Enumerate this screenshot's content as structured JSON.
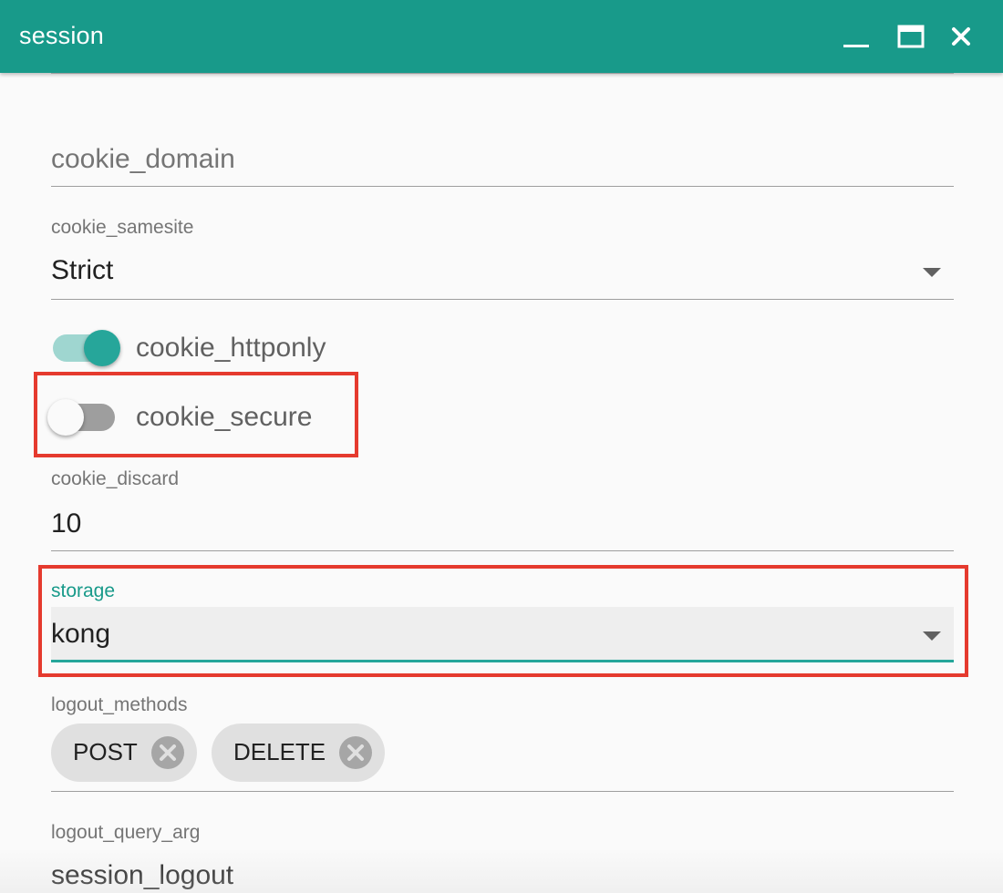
{
  "window": {
    "title": "session",
    "minimize_icon": "minimize-icon",
    "maximize_icon": "maximize-icon",
    "close_icon": "close-icon"
  },
  "form": {
    "cookie_domain": {
      "placeholder": "cookie_domain",
      "value": ""
    },
    "cookie_samesite": {
      "label": "cookie_samesite",
      "value": "Strict"
    },
    "cookie_httponly": {
      "label": "cookie_httponly",
      "checked": true
    },
    "cookie_secure": {
      "label": "cookie_secure",
      "checked": false
    },
    "cookie_discard": {
      "label": "cookie_discard",
      "value": "10"
    },
    "storage": {
      "label": "storage",
      "value": "kong",
      "focused": true
    },
    "logout_methods": {
      "label": "logout_methods",
      "chips": [
        "POST",
        "DELETE"
      ]
    },
    "logout_query_arg": {
      "label": "logout_query_arg",
      "value": "session_logout"
    }
  },
  "colors": {
    "primary": "#189a8a",
    "accent": "#26a69a",
    "highlight_border": "#e53a2e",
    "toggle_off_track": "#9e9e9e"
  }
}
